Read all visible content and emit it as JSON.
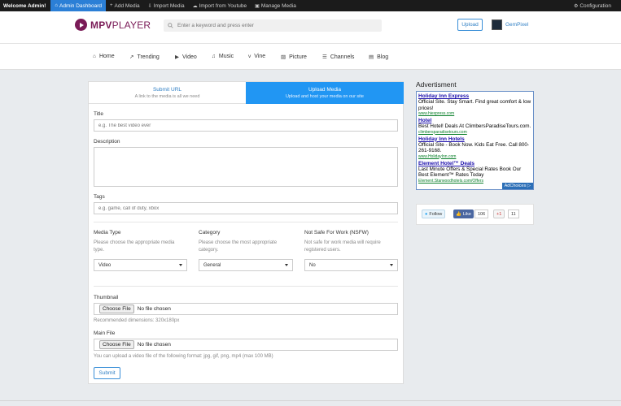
{
  "adminbar": {
    "welcome": "Welcome Admin!",
    "items": [
      {
        "icon": "dashboard-icon",
        "glyph": "⌂",
        "label": "Admin Dashboard"
      },
      {
        "icon": "plus-icon",
        "glyph": "+",
        "label": "Add Media"
      },
      {
        "icon": "import-icon",
        "glyph": "⇩",
        "label": "Import Media"
      },
      {
        "icon": "cloud-icon",
        "glyph": "☁",
        "label": "Import from Youtube"
      },
      {
        "icon": "film-icon",
        "glyph": "▣",
        "label": "Manage Media"
      }
    ],
    "config": {
      "glyph": "⚙",
      "label": "Configuration"
    }
  },
  "header": {
    "logo_bold": "MPV",
    "logo_light": "PLAYER",
    "search_placeholder": "Enter a keyword and press enter",
    "upload_label": "Upload",
    "username": "GemPixel"
  },
  "nav": [
    {
      "icon": "home-icon",
      "glyph": "⌂",
      "label": "Home"
    },
    {
      "icon": "flame-icon",
      "glyph": "↗",
      "label": "Trending"
    },
    {
      "icon": "video-icon",
      "glyph": "▶",
      "label": "Video"
    },
    {
      "icon": "music-icon",
      "glyph": "♫",
      "label": "Music"
    },
    {
      "icon": "vine-icon",
      "glyph": "v",
      "label": "Vine"
    },
    {
      "icon": "picture-icon",
      "glyph": "▨",
      "label": "Picture"
    },
    {
      "icon": "channels-icon",
      "glyph": "☰",
      "label": "Channels"
    },
    {
      "icon": "blog-icon",
      "glyph": "▤",
      "label": "Blog"
    }
  ],
  "form": {
    "tabs": [
      {
        "title": "Submit URL",
        "subtitle": "A link to the media is all we need"
      },
      {
        "title": "Upload Media",
        "subtitle": "Upload and host your media on our site"
      }
    ],
    "title_label": "Title",
    "title_placeholder": "e.g. The best video ever",
    "description_label": "Description",
    "tags_label": "Tags",
    "tags_placeholder": "e.g. game, call of duty, xbox",
    "media_type": {
      "label": "Media Type",
      "hint": "Please choose the appropriate media type.",
      "value": "Video"
    },
    "category": {
      "label": "Category",
      "hint": "Please choose the most appropriate category.",
      "value": "General"
    },
    "nsfw": {
      "label": "Not Safe For Work (NSFW)",
      "hint": "Not safe for work media will require registered users.",
      "value": "No"
    },
    "thumbnail": {
      "label": "Thumbnail",
      "button": "Choose File",
      "status": "No file chosen",
      "hint": "Recommended dimensions: 320x180px"
    },
    "main_file": {
      "label": "Main File",
      "button": "Choose File",
      "status": "No file chosen",
      "hint": "You can upload a video file of the following format: jpg, gif, png, mp4 (max 100 MB)"
    },
    "submit_label": "Submit"
  },
  "sidebar": {
    "ad_title": "Advertisment",
    "ads": [
      {
        "headline": "Holiday Inn Express",
        "desc": "Official Site. Stay Smart. Find great comfort & low prices!",
        "url": "www.hiexpress.com"
      },
      {
        "headline": "Hotel",
        "desc": "Best Hotel! Deals At ClimbersParadiseTours.com.",
        "url": "climbersparadisetours.com"
      },
      {
        "headline": "Holiday Inn Hotels",
        "desc": "Official Site - Book Now. Kids Eat Free. Call 800-261-9168.",
        "url": "www.HolidayInn.com"
      },
      {
        "headline": "Element Hotel™ Deals",
        "desc": "Last Minute Offers & Special Rates Book Our Best Element™ Rates Today",
        "url": "Element.Starwoodhotels.com/Offers"
      }
    ],
    "adchoices": "AdChoices ▷",
    "social": {
      "twitter": "Follow",
      "facebook": "Like",
      "facebook_count": "106",
      "google": "+1",
      "google_count": "11"
    }
  },
  "colors": {
    "accent": "#2196f3",
    "brand": "#7a1b57",
    "adminbar": "#1b1b1b"
  }
}
